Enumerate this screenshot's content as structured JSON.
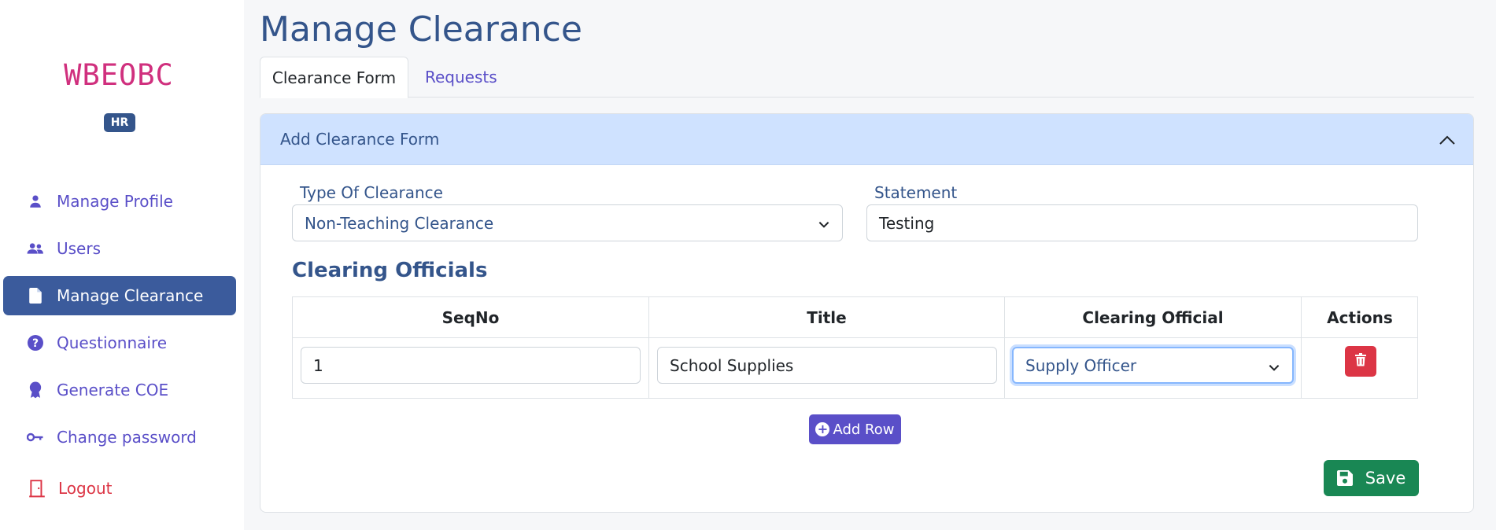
{
  "brand": {
    "name": "WBEOBC",
    "role": "HR"
  },
  "sidebar": {
    "items": [
      {
        "label": "Manage Profile",
        "icon": "user-icon"
      },
      {
        "label": "Users",
        "icon": "users-icon"
      },
      {
        "label": "Manage Clearance",
        "icon": "file-icon",
        "active": true
      },
      {
        "label": "Questionnaire",
        "icon": "question-circle-icon"
      },
      {
        "label": "Generate COE",
        "icon": "award-icon"
      },
      {
        "label": "Change password",
        "icon": "key-icon"
      },
      {
        "label": "Logout",
        "icon": "logout-door-icon"
      }
    ]
  },
  "page": {
    "title": "Manage Clearance"
  },
  "tabs": [
    {
      "label": "Clearance Form",
      "active": true
    },
    {
      "label": "Requests",
      "active": false
    }
  ],
  "card": {
    "header": "Add Clearance Form",
    "type_label": "Type Of Clearance",
    "type_value": "Non-Teaching Clearance",
    "statement_label": "Statement",
    "statement_value": "Testing",
    "officials_title": "Clearing Officials",
    "table": {
      "columns": [
        "SeqNo",
        "Title",
        "Clearing Official",
        "Actions"
      ],
      "rows": [
        {
          "seq": "1",
          "title": "School Supplies",
          "official": "Supply Officer"
        }
      ]
    },
    "add_row_label": "Add Row",
    "save_label": "Save"
  },
  "colors": {
    "brand": "#d0307e",
    "primary": "#34558b",
    "accent": "#5a4fc8",
    "danger": "#dc3545",
    "success": "#198754",
    "header_bg": "#cfe2ff"
  }
}
